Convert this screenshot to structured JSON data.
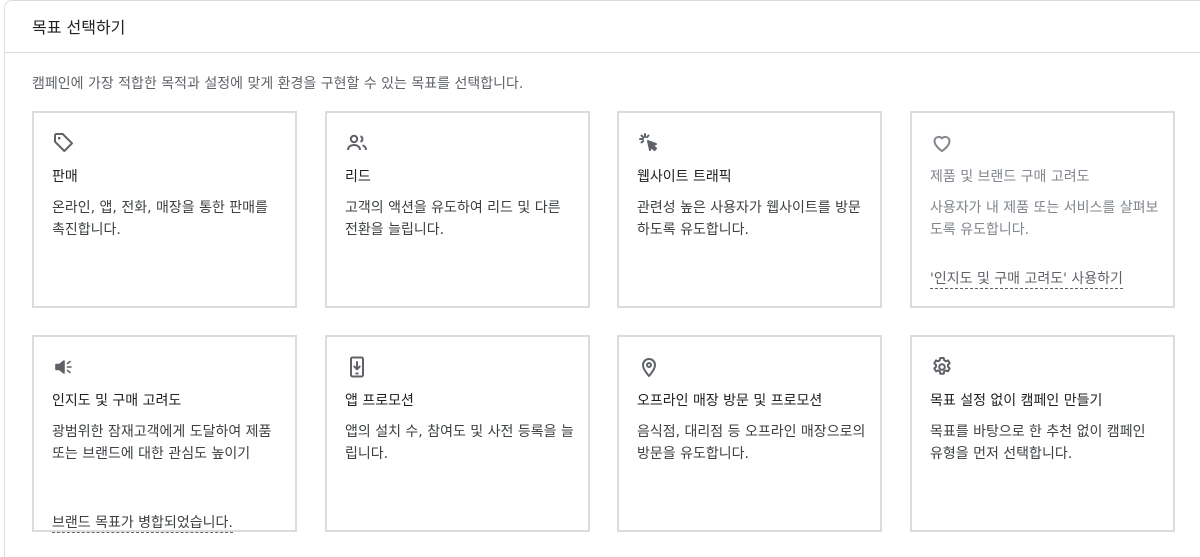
{
  "header": {
    "title": "목표 선택하기"
  },
  "intro": "캠페인에 가장 적합한 목적과 설정에 맞게 환경을 구현할 수 있는 목표를 선택합니다.",
  "cards": [
    {
      "icon": "tag-icon",
      "title": "판매",
      "desc": "온라인, 앱, 전화, 매장을 통한 판매를 촉진합니다."
    },
    {
      "icon": "people-icon",
      "title": "리드",
      "desc": "고객의 액션을 유도하여 리드 및 다른 전환을 늘립니다."
    },
    {
      "icon": "cursor-click-icon",
      "title": "웹사이트 트래픽",
      "desc": "관련성 높은 사용자가 웹사이트를 방문하도록 유도합니다."
    },
    {
      "icon": "heart-icon",
      "title": "제품 및 브랜드 구매 고려도",
      "desc": "사용자가 내 제품 또는 서비스를 살펴보도록 유도합니다.",
      "link": "'인지도 및 구매 고려도' 사용하기"
    },
    {
      "icon": "megaphone-icon",
      "title": "인지도 및 구매 고려도",
      "desc": "광범위한 잠재고객에게 도달하여 제품 또는 브랜드에 대한 관심도 높이기",
      "link": "브랜드 목표가 병합되었습니다."
    },
    {
      "icon": "phone-download-icon",
      "title": "앱 프로모션",
      "desc": "앱의 설치 수, 참여도 및 사전 등록을 늘립니다."
    },
    {
      "icon": "location-pin-icon",
      "title": "오프라인 매장 방문 및 프로모션",
      "desc": "음식점, 대리점 등 오프라인 매장으로의 방문을 유도합니다."
    },
    {
      "icon": "gear-icon",
      "title": "목표 설정 없이 캠페인 만들기",
      "desc": "목표를 바탕으로 한 추천 없이 캠페인 유형을 먼저 선택합니다."
    }
  ]
}
